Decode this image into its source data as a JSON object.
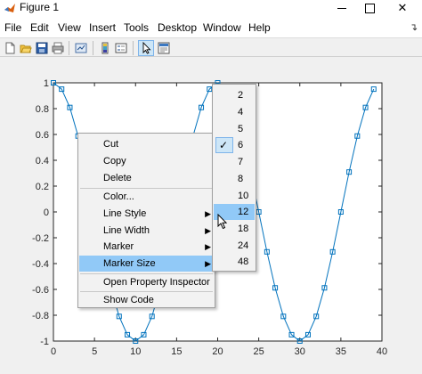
{
  "window": {
    "title": "Figure 1",
    "icon": "matlab-icon"
  },
  "menubar": {
    "items": [
      "File",
      "Edit",
      "View",
      "Insert",
      "Tools",
      "Desktop",
      "Window",
      "Help"
    ],
    "overflow_icon": "dock-arrow-icon"
  },
  "toolbar": {
    "buttons": [
      "new-figure-icon",
      "open-icon",
      "save-icon",
      "print-icon",
      "link-plot-icon",
      "insert-colorbar-icon",
      "insert-legend-icon",
      "edit-plot-icon",
      "property-editor-icon"
    ],
    "active": "edit-plot-icon"
  },
  "chart_data": {
    "type": "line",
    "title": "",
    "xlabel": "",
    "ylabel": "",
    "xlim": [
      0,
      40
    ],
    "ylim": [
      -1,
      1
    ],
    "xticks": [
      0,
      5,
      10,
      15,
      20,
      25,
      30,
      35,
      40
    ],
    "yticks": [
      -1,
      -0.8,
      -0.6,
      -0.4,
      -0.2,
      0,
      0.2,
      0.4,
      0.6,
      0.8,
      1
    ],
    "xtick_labels": [
      "0",
      "5",
      "10",
      "15",
      "20",
      "25",
      "30",
      "35",
      "40"
    ],
    "ytick_labels": [
      "-1",
      "-0.8",
      "-0.6",
      "-0.4",
      "-0.2",
      "0",
      "0.2",
      "0.4",
      "0.6",
      "0.8",
      "1"
    ],
    "marker": "square",
    "line_color": "#0072bd",
    "grid": false,
    "series": [
      {
        "x": [
          0,
          1,
          2,
          3,
          4,
          5,
          6,
          7,
          8,
          9,
          10,
          11,
          12,
          13,
          14,
          15,
          16,
          17,
          18,
          19,
          20,
          21,
          22,
          23,
          24,
          25,
          26,
          27,
          28,
          29,
          30,
          31,
          32,
          33,
          34,
          35,
          36,
          37,
          38,
          39
        ],
        "y": [
          1,
          0.951,
          0.809,
          0.588,
          0.309,
          0,
          -0.309,
          -0.588,
          -0.809,
          -0.951,
          -1,
          -0.951,
          -0.809,
          -0.588,
          -0.309,
          0,
          0.309,
          0.588,
          0.809,
          0.951,
          1,
          0.951,
          0.809,
          0.588,
          0.309,
          0,
          -0.309,
          -0.588,
          -0.809,
          -0.951,
          -1,
          -0.951,
          -0.809,
          -0.588,
          -0.309,
          0,
          0.309,
          0.588,
          0.809,
          0.951
        ]
      }
    ]
  },
  "context_menu": {
    "items": [
      {
        "label": "Cut"
      },
      {
        "label": "Copy"
      },
      {
        "label": "Delete"
      },
      {
        "label": "Color..."
      },
      {
        "label": "Line Style"
      },
      {
        "label": "Line Width"
      },
      {
        "label": "Marker"
      },
      {
        "label": "Marker Size"
      },
      {
        "label": "Open Property Inspector"
      },
      {
        "label": "Show Code"
      }
    ],
    "submenu_arrow": "▶",
    "highlighted": "Marker Size"
  },
  "marker_size_menu": {
    "items": [
      "2",
      "4",
      "5",
      "6",
      "7",
      "8",
      "10",
      "12",
      "18",
      "24",
      "48"
    ],
    "checked": "6",
    "highlighted": "12"
  },
  "colors": {
    "highlight": "#91c9f7",
    "menu_bg": "#f2f2f2",
    "figure_bg": "#f0f0f0",
    "line": "#0072bd"
  }
}
